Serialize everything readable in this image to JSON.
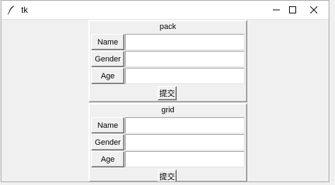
{
  "window": {
    "title": "tk",
    "controls": {
      "minimize": "minimize-icon",
      "maximize": "maximize-icon",
      "close": "close-icon"
    }
  },
  "pack_frame": {
    "title": "pack",
    "fields": [
      {
        "label": "Name",
        "value": ""
      },
      {
        "label": "Gender",
        "value": ""
      },
      {
        "label": "Age",
        "value": ""
      }
    ],
    "submit_label": "提交"
  },
  "grid_frame": {
    "title": "grid",
    "fields": [
      {
        "label": "Name",
        "value": ""
      },
      {
        "label": "Gender",
        "value": ""
      },
      {
        "label": "Age",
        "value": ""
      }
    ],
    "submit_label": "提交"
  },
  "colors": {
    "window_bg": "#f0f0f0",
    "titlebar_bg": "#ffffff",
    "entry_bg": "#ffffff"
  }
}
